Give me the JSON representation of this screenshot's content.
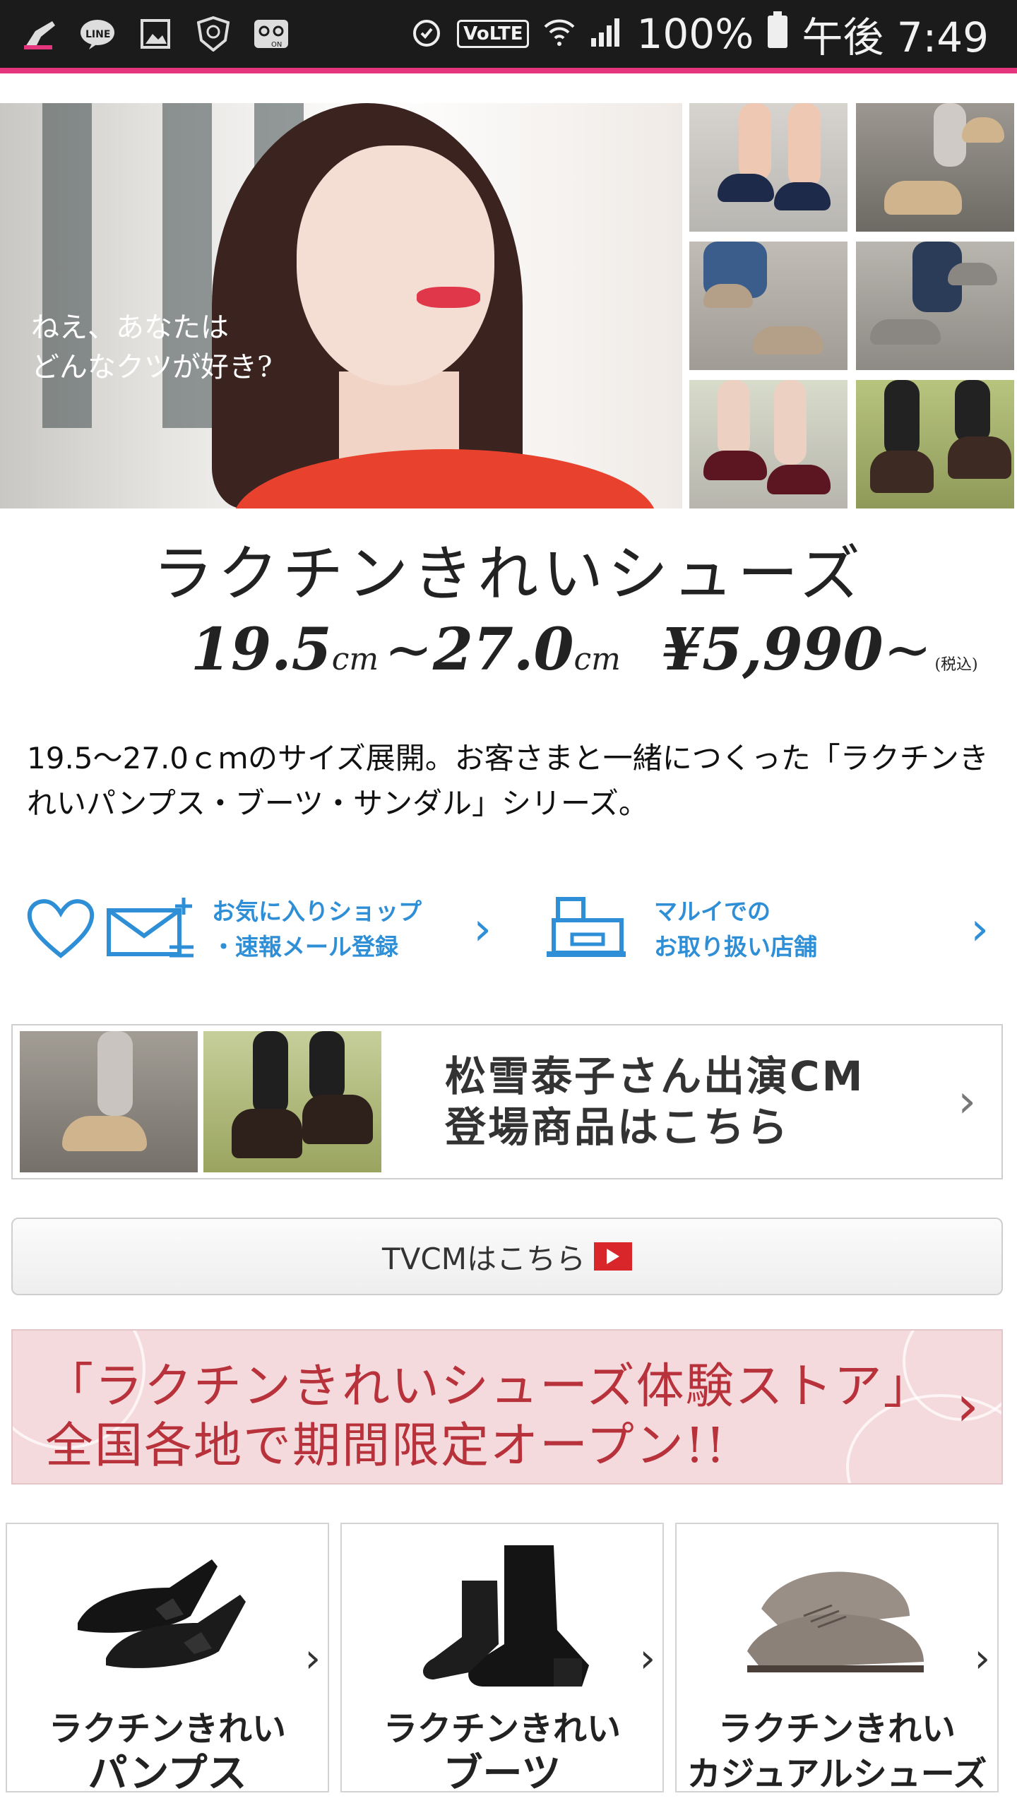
{
  "status_bar": {
    "time": "午後 7:49",
    "battery_percent": "100%",
    "volte_label": "VoLTE",
    "left_icons": [
      "broom-icon",
      "line-app-icon",
      "image-icon",
      "shield-icon",
      "voicemail-icon"
    ],
    "right_icons": [
      "alarm-icon",
      "wifi-icon",
      "signal-icon",
      "battery-icon"
    ]
  },
  "hero": {
    "caption": "ねえ、あなたは\nどんなクツが好き?"
  },
  "product": {
    "title": "ラクチンきれいシューズ",
    "size_from": "19.5",
    "size_to": "27.0",
    "size_unit": "cm",
    "tilde": "~",
    "price": "¥5,990",
    "price_suffix": "~",
    "tax_note": "(税込)"
  },
  "description": "19.5〜27.0ｃｍのサイズ展開。お客さまと一緒につくった「ラクチンきれいパンプス・ブーツ・サンダル」シリーズ。",
  "links": {
    "favorite_shop": "お気に入りショップ\n・速報メール登録",
    "stores": "マルイでの\nお取り扱い店舗",
    "chevron": "›"
  },
  "cm_banner": {
    "text": "松雪泰子さん出演CM\n登場商品はこちら",
    "chevron": "›"
  },
  "tvcm_button": {
    "label": "TVCMはこちら"
  },
  "store_banner": {
    "text": "「ラクチンきれいシューズ体験ストア」\n全国各地で期間限定オープン!!",
    "chevron": "›"
  },
  "categories": [
    {
      "line1": "ラクチンきれい",
      "line2": "パンプス"
    },
    {
      "line1": "ラクチンきれい",
      "line2": "ブーツ"
    },
    {
      "line1": "ラクチンきれい",
      "line2": "カジュアルシューズ"
    }
  ],
  "colors": {
    "accent_pink": "#e5357c",
    "link_blue": "#2f8fd6",
    "store_red": "#b8323b",
    "store_bg": "#f5dadd"
  }
}
